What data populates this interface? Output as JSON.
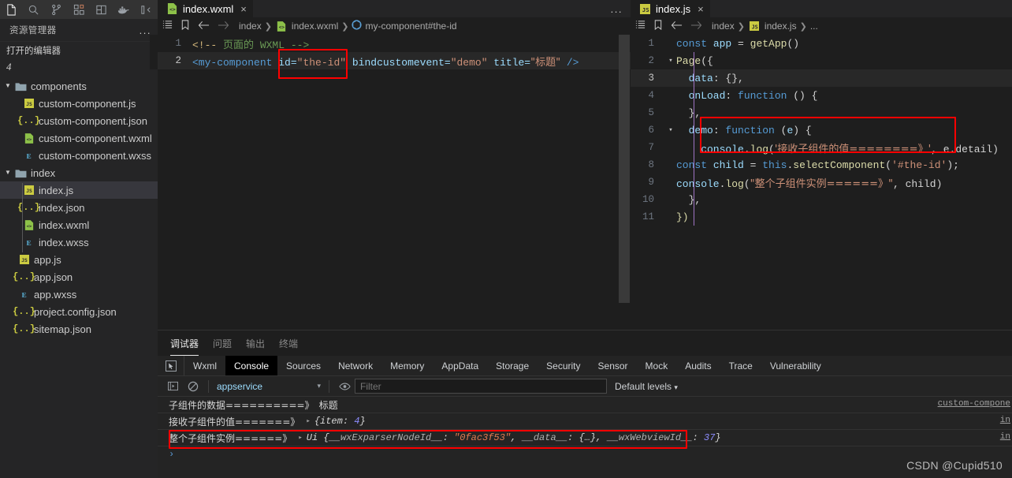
{
  "activity_bar": {
    "items": [
      {
        "name": "explorer-icon",
        "glyph": "files",
        "active": true
      },
      {
        "name": "search-icon",
        "glyph": "search",
        "active": false
      },
      {
        "name": "source-control-icon",
        "glyph": "branch",
        "active": false
      },
      {
        "name": "extensions-icon",
        "glyph": "squares",
        "active": false
      },
      {
        "name": "layout-icon",
        "glyph": "layout",
        "active": false
      },
      {
        "name": "docker-icon",
        "glyph": "docker",
        "active": false
      },
      {
        "name": "remote-icon",
        "glyph": "remote",
        "active": false
      }
    ]
  },
  "sidebar": {
    "title": "资源管理器",
    "more_label": "...",
    "open_editors_label": "打开的编辑器",
    "open_editors_count": "4",
    "tree": [
      {
        "label": "components",
        "indent": 1,
        "type": "folder",
        "expanded": true,
        "selected": false
      },
      {
        "label": "custom-component.js",
        "indent": 2,
        "type": "js",
        "selected": false
      },
      {
        "label": "custom-component.json",
        "indent": 2,
        "type": "json",
        "selected": false
      },
      {
        "label": "custom-component.wxml",
        "indent": 2,
        "type": "wxml",
        "selected": false
      },
      {
        "label": "custom-component.wxss",
        "indent": 2,
        "type": "wxss",
        "selected": false
      },
      {
        "label": "index",
        "indent": 1,
        "type": "folder",
        "expanded": true,
        "selected": false
      },
      {
        "label": "index.js",
        "indent": 2,
        "type": "js",
        "selected": true
      },
      {
        "label": "index.json",
        "indent": 2,
        "type": "json",
        "selected": false
      },
      {
        "label": "index.wxml",
        "indent": 2,
        "type": "wxml",
        "selected": false
      },
      {
        "label": "index.wxss",
        "indent": 2,
        "type": "wxss",
        "selected": false
      },
      {
        "label": "app.js",
        "indent": 1.5,
        "type": "js",
        "selected": false
      },
      {
        "label": "app.json",
        "indent": 1.5,
        "type": "json",
        "selected": false
      },
      {
        "label": "app.wxss",
        "indent": 1.5,
        "type": "wxss",
        "selected": false
      },
      {
        "label": "project.config.json",
        "indent": 1.5,
        "type": "json",
        "selected": false
      },
      {
        "label": "sitemap.json",
        "indent": 1.5,
        "type": "json",
        "selected": false
      }
    ]
  },
  "editor_left": {
    "tab": {
      "label": "index.wxml",
      "icon": "wxml-file-icon",
      "close": "×"
    },
    "tab_actions": "...",
    "breadcrumb": [
      "index",
      "index.wxml",
      "my-component#the-id"
    ],
    "lines": [
      {
        "num": "1",
        "content": "comment"
      },
      {
        "num": "2",
        "content": "element"
      }
    ],
    "code": {
      "comment_open": "<!-- ",
      "comment_zh": "页面的",
      "comment_rest": " WXML -->",
      "tag_open": "<my-component",
      "attr_id": " id=",
      "attr_id_val": "\"the-id\"",
      "attr_bind": " bindcustomevent=",
      "attr_bind_val": "\"demo\"",
      "attr_title": " title=",
      "attr_title_val": "\"标题\"",
      "tag_close": " />"
    }
  },
  "editor_right": {
    "tab": {
      "label": "index.js",
      "icon": "js-file-icon",
      "close": "×"
    },
    "breadcrumb": [
      "index",
      "index.js",
      "..."
    ],
    "lines": [
      {
        "num": "1",
        "fold": ""
      },
      {
        "num": "2",
        "fold": "v"
      },
      {
        "num": "3",
        "fold": ""
      },
      {
        "num": "4",
        "fold": ""
      },
      {
        "num": "5",
        "fold": ""
      },
      {
        "num": "6",
        "fold": "v"
      },
      {
        "num": "7",
        "fold": ""
      },
      {
        "num": "8",
        "fold": ""
      },
      {
        "num": "9",
        "fold": ""
      },
      {
        "num": "10",
        "fold": ""
      },
      {
        "num": "11",
        "fold": ""
      }
    ],
    "code": {
      "l1_kw": "const",
      "l1_var": " app ",
      "l1_eq": "= ",
      "l1_fn": "getApp",
      "l1_par": "()",
      "l2_fn": "Page",
      "l2_par": "({",
      "l3_prop": "  data",
      "l3_rest": ": {},",
      "l4_prop": "  onLoad",
      "l4_colon": ": ",
      "l4_kw": "function",
      "l4_rest": " () {",
      "l5": "  },",
      "l6_prop": "  demo",
      "l6_colon": ": ",
      "l6_kw": "function",
      "l6_mid": " (",
      "l6_arg": "e",
      "l6_end": ") {",
      "l7_obj": "    console",
      "l7_dot": ".",
      "l7_fn": "log",
      "l7_open": "(",
      "l7_str": "'接收子组件的值========》'",
      "l7_rest": ", e.detail)",
      "l8_kw": "const",
      "l8_var": " child ",
      "l8_eq": "= ",
      "l8_this": "this",
      "l8_dot": ".",
      "l8_fn": "selectComponent",
      "l8_open": "(",
      "l8_str": "'#the-id'",
      "l8_end": ");",
      "l9_obj": "console",
      "l9_dot": ".",
      "l9_fn": "log",
      "l9_open": "(",
      "l9_str": "\"整个子组件实例======》\"",
      "l9_rest": ", child)",
      "l10": "  },",
      "l11": "})"
    }
  },
  "panel": {
    "tabs": [
      {
        "label": "调试器",
        "active": true
      },
      {
        "label": "问题",
        "active": false
      },
      {
        "label": "输出",
        "active": false
      },
      {
        "label": "终端",
        "active": false
      }
    ]
  },
  "devtools": {
    "inspect_icon": "cursor-select-icon",
    "tabs": [
      {
        "label": "Wxml",
        "active": false
      },
      {
        "label": "Console",
        "active": true
      },
      {
        "label": "Sources",
        "active": false
      },
      {
        "label": "Network",
        "active": false
      },
      {
        "label": "Memory",
        "active": false
      },
      {
        "label": "AppData",
        "active": false
      },
      {
        "label": "Storage",
        "active": false
      },
      {
        "label": "Security",
        "active": false
      },
      {
        "label": "Sensor",
        "active": false
      },
      {
        "label": "Mock",
        "active": false
      },
      {
        "label": "Audits",
        "active": false
      },
      {
        "label": "Trace",
        "active": false
      },
      {
        "label": "Vulnerability",
        "active": false
      }
    ],
    "toolbar": {
      "sidebar_toggle": "console-sidebar-icon",
      "clear": "clear-console-icon",
      "context": "appservice",
      "context_caret": "▾",
      "eye": "eye-icon",
      "filter_placeholder": "Filter",
      "filter_value": "",
      "levels": "Default levels",
      "levels_caret": "▾"
    },
    "console_rows": [
      {
        "label": "子组件的数据==========》",
        "value_plain": " 标题",
        "expandable": false,
        "source": "custom-compone",
        "highlighted": false
      },
      {
        "label": "接收子组件的值=======》",
        "value_obj": "{item: ",
        "value_num": "4",
        "value_tail": "}",
        "expandable": true,
        "source": "in",
        "highlighted": false
      },
      {
        "label": "整个子组件实例======》",
        "obj_name": "Ui ",
        "obj_open": "{",
        "k1": "__wxExparserNodeId__",
        "v1": "\"0fac3f53\"",
        "k2": "__data__",
        "v2": "{…}",
        "k3": "__wxWebviewId__",
        "v3": "37",
        "obj_close": "}",
        "expandable": true,
        "source": "in",
        "highlighted": true
      }
    ],
    "prompt": "›"
  },
  "watermark": "CSDN @Cupid510",
  "colors": {
    "accent_red": "#ff0000",
    "editor_bg": "#1e1e1e",
    "sidebar_bg": "#252526",
    "panel_bg": "#242424"
  }
}
